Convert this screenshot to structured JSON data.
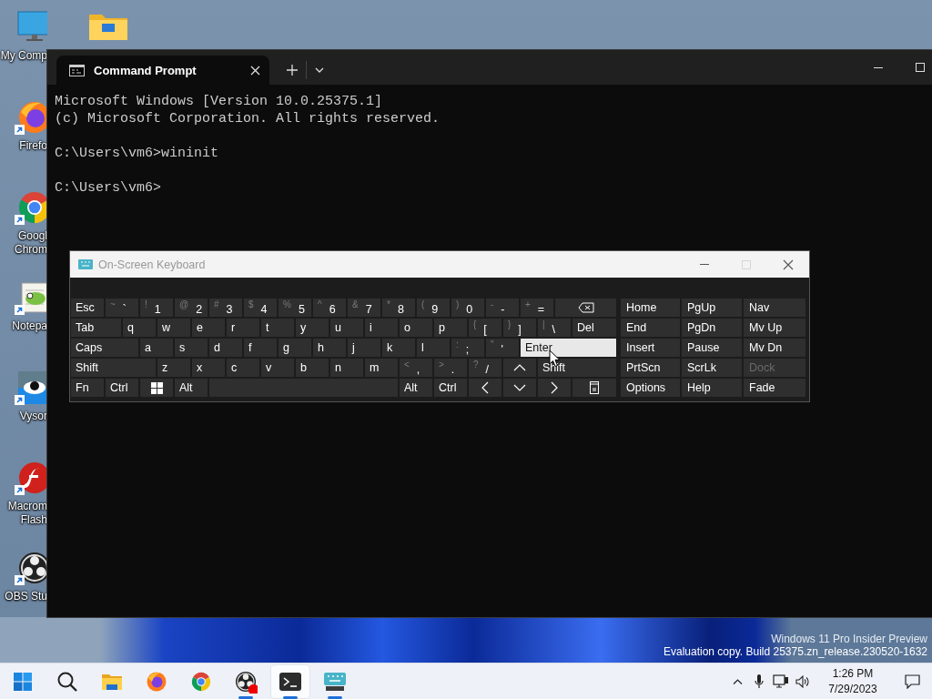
{
  "desktop_icons": [
    {
      "kind": "monitor",
      "shortcut": false,
      "label_lines": [
        "My Comp"
      ]
    },
    {
      "kind": "firefox",
      "shortcut": true,
      "label_lines": [
        "Firefo"
      ]
    },
    {
      "kind": "chrome",
      "shortcut": true,
      "label_lines": [
        "Googl",
        "Chrom"
      ]
    },
    {
      "kind": "notepad",
      "shortcut": true,
      "label_lines": [
        "Notepa"
      ]
    },
    {
      "kind": "vysor",
      "shortcut": true,
      "label_lines": [
        "Vysor"
      ]
    },
    {
      "kind": "flash",
      "shortcut": true,
      "label_lines": [
        "Macrom",
        "Flash"
      ]
    },
    {
      "kind": "obs",
      "shortcut": true,
      "label_lines": [
        "OBS Stu"
      ]
    }
  ],
  "terminal": {
    "tabs": [
      {
        "title": "Command Prompt",
        "selected": true
      }
    ],
    "paragraphs": [
      [
        "Microsoft Windows [Version 10.0.25375.1]",
        "(c) Microsoft Corporation. All rights reserved."
      ],
      [
        "C:\\Users\\vm6>wininit"
      ],
      [
        "C:\\Users\\vm6>"
      ]
    ]
  },
  "keyboard": {
    "title": "On-Screen Keyboard",
    "active": false,
    "window_buttons": [
      {
        "kind": "minimize",
        "disabled": false
      },
      {
        "kind": "maximize",
        "disabled": true
      },
      {
        "kind": "close",
        "disabled": false
      }
    ],
    "rows": [
      {
        "keys": [
          {
            "kind": "key",
            "label": "Esc",
            "hover": false
          },
          {
            "kind": "key",
            "shift": "~",
            "label": "`",
            "hover": false
          },
          {
            "kind": "key",
            "shift": "!",
            "label": "1",
            "hover": false
          },
          {
            "kind": "key",
            "shift": "@",
            "label": "2",
            "hover": false
          },
          {
            "kind": "key",
            "shift": "#",
            "label": "3",
            "hover": false
          },
          {
            "kind": "key",
            "shift": "$",
            "label": "4",
            "hover": false
          },
          {
            "kind": "key",
            "shift": "%",
            "label": "5",
            "hover": false
          },
          {
            "kind": "key",
            "shift": "^",
            "label": "6",
            "hover": false
          },
          {
            "kind": "key",
            "shift": "&",
            "label": "7",
            "hover": false
          },
          {
            "kind": "key",
            "shift": "*",
            "label": "8",
            "hover": false
          },
          {
            "kind": "key",
            "shift": "(",
            "label": "9",
            "hover": false
          },
          {
            "kind": "key",
            "shift": ")",
            "label": "0",
            "hover": false
          },
          {
            "kind": "key",
            "shift": "-",
            "label": "-",
            "hover": false
          },
          {
            "kind": "key",
            "shift": "+",
            "label": "=",
            "hover": false
          },
          {
            "kind": "backspace",
            "hover": false
          }
        ]
      },
      {
        "keys": [
          {
            "kind": "key",
            "label": "Tab",
            "hover": false
          },
          {
            "kind": "key",
            "label": "q",
            "hover": false
          },
          {
            "kind": "key",
            "label": "w",
            "hover": false
          },
          {
            "kind": "key",
            "label": "e",
            "hover": false
          },
          {
            "kind": "key",
            "label": "r",
            "hover": false
          },
          {
            "kind": "key",
            "label": "t",
            "hover": false
          },
          {
            "kind": "key",
            "label": "y",
            "hover": false
          },
          {
            "kind": "key",
            "label": "u",
            "hover": false
          },
          {
            "kind": "key",
            "label": "i",
            "hover": false
          },
          {
            "kind": "key",
            "label": "o",
            "hover": false
          },
          {
            "kind": "key",
            "label": "p",
            "hover": false
          },
          {
            "kind": "key",
            "shift": "{",
            "label": "[",
            "hover": false
          },
          {
            "kind": "key",
            "shift": "}",
            "label": "]",
            "hover": false
          },
          {
            "kind": "key",
            "shift": "|",
            "label": "\\",
            "hover": false
          },
          {
            "kind": "key",
            "label": "Del",
            "hover": false
          }
        ]
      },
      {
        "keys": [
          {
            "kind": "key",
            "label": "Caps",
            "hover": false
          },
          {
            "kind": "key",
            "label": "a",
            "hover": false
          },
          {
            "kind": "key",
            "label": "s",
            "hover": false
          },
          {
            "kind": "key",
            "label": "d",
            "hover": false
          },
          {
            "kind": "key",
            "label": "f",
            "hover": false
          },
          {
            "kind": "key",
            "label": "g",
            "hover": false
          },
          {
            "kind": "key",
            "label": "h",
            "hover": false
          },
          {
            "kind": "key",
            "label": "j",
            "hover": false
          },
          {
            "kind": "key",
            "label": "k",
            "hover": false
          },
          {
            "kind": "key",
            "label": "l",
            "hover": false
          },
          {
            "kind": "key",
            "shift": ":",
            "label": ";",
            "hover": false
          },
          {
            "kind": "key",
            "shift": "\"",
            "label": "'",
            "hover": false
          },
          {
            "kind": "key",
            "label": "Enter",
            "hover": true
          }
        ]
      },
      {
        "keys": [
          {
            "kind": "key",
            "label": "Shift",
            "hover": false
          },
          {
            "kind": "key",
            "label": "z",
            "hover": false
          },
          {
            "kind": "key",
            "label": "x",
            "hover": false
          },
          {
            "kind": "key",
            "label": "c",
            "hover": false
          },
          {
            "kind": "key",
            "label": "v",
            "hover": false
          },
          {
            "kind": "key",
            "label": "b",
            "hover": false
          },
          {
            "kind": "key",
            "label": "n",
            "hover": false
          },
          {
            "kind": "key",
            "label": "m",
            "hover": false
          },
          {
            "kind": "key",
            "shift": "<",
            "label": ",",
            "hover": false
          },
          {
            "kind": "key",
            "shift": ">",
            "label": ".",
            "hover": false
          },
          {
            "kind": "key",
            "shift": "?",
            "label": "/",
            "hover": false
          },
          {
            "kind": "up",
            "hover": false
          },
          {
            "kind": "key",
            "label": "Shift",
            "hover": false
          }
        ]
      },
      {
        "keys": [
          {
            "kind": "key",
            "label": "Fn",
            "hover": false
          },
          {
            "kind": "key",
            "label": "Ctrl",
            "hover": false
          },
          {
            "kind": "windows",
            "hover": false
          },
          {
            "kind": "key",
            "label": "Alt",
            "hover": false
          },
          {
            "kind": "space",
            "hover": false
          },
          {
            "kind": "key",
            "label": "Alt",
            "hover": false
          },
          {
            "kind": "key",
            "label": "Ctrl",
            "hover": false
          },
          {
            "kind": "left",
            "hover": false
          },
          {
            "kind": "down",
            "hover": false
          },
          {
            "kind": "right",
            "hover": false
          },
          {
            "kind": "menu",
            "hover": false
          }
        ]
      }
    ],
    "nav_rows": [
      [
        {
          "label": "Home",
          "disabled": false
        },
        {
          "label": "PgUp",
          "disabled": false
        },
        {
          "label": "Nav",
          "disabled": false
        }
      ],
      [
        {
          "label": "End",
          "disabled": false
        },
        {
          "label": "PgDn",
          "disabled": false
        },
        {
          "label": "Mv Up",
          "disabled": false
        }
      ],
      [
        {
          "label": "Insert",
          "disabled": false
        },
        {
          "label": "Pause",
          "disabled": false
        },
        {
          "label": "Mv Dn",
          "disabled": false
        }
      ],
      [
        {
          "label": "PrtScn",
          "disabled": false
        },
        {
          "label": "ScrLk",
          "disabled": false
        },
        {
          "label": "Dock",
          "disabled": true
        }
      ],
      [
        {
          "label": "Options",
          "disabled": false
        },
        {
          "label": "Help",
          "disabled": false
        },
        {
          "label": "Fade",
          "disabled": false
        }
      ]
    ]
  },
  "watermark": [
    "Windows 11 Pro Insider Preview",
    "Evaluation copy. Build 25375.zn_release.230520-1632"
  ],
  "taskbar": {
    "apps": [
      {
        "kind": "start",
        "running": false,
        "selected": false
      },
      {
        "kind": "search",
        "running": false,
        "selected": false
      },
      {
        "kind": "explorer",
        "running": false,
        "selected": false
      },
      {
        "kind": "firefox",
        "running": false,
        "selected": false
      },
      {
        "kind": "chrome",
        "running": false,
        "selected": false
      },
      {
        "kind": "obs",
        "running": true,
        "selected": false
      },
      {
        "kind": "terminal",
        "running": true,
        "selected": true
      },
      {
        "kind": "keyboard",
        "running": true,
        "selected": false
      }
    ],
    "time": "1:26 PM",
    "date": "7/29/2023"
  }
}
